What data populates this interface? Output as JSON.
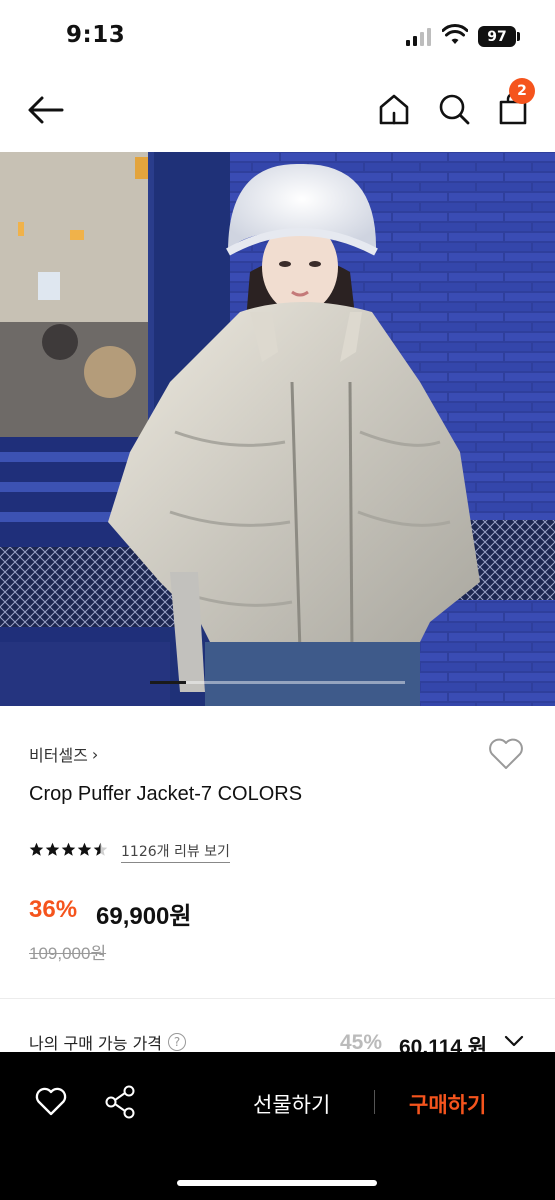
{
  "status_bar": {
    "time": "9:13",
    "battery": "97"
  },
  "header": {
    "cart_count": "2"
  },
  "gallery": {
    "progress": 0.14
  },
  "product": {
    "brand": "비터셀즈",
    "brand_chevron": "›",
    "title": "Crop Puffer Jacket-7 COLORS",
    "rating": 4.5,
    "review_link": "1126개 리뷰 보기",
    "discount": "36%",
    "price": "69,900원",
    "original_price": "109,000원"
  },
  "my_price": {
    "label": "나의 구매 가능 가격",
    "help": "?",
    "discount": "45%",
    "price": "60,114 원"
  },
  "bottom_bar": {
    "gift_label": "선물하기",
    "buy_label": "구매하기"
  },
  "colors": {
    "accent": "#f5541d",
    "bottom_bar": "#000000",
    "wall": "#2b3c94"
  },
  "icons": [
    "back-arrow-icon",
    "home-icon",
    "search-icon",
    "shopping-bag-icon",
    "heart-icon",
    "star-icon",
    "help-icon",
    "chevron-down-icon",
    "share-icon"
  ]
}
